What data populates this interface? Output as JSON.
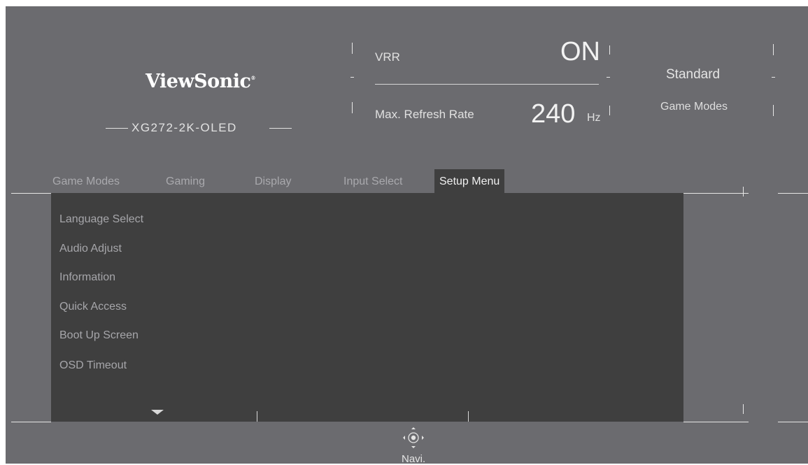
{
  "brand": {
    "logo": "ViewSonic",
    "model": "XG272-2K-OLED"
  },
  "status": {
    "vrr_label": "VRR",
    "vrr_value": "ON",
    "refresh_label": "Max. Refresh Rate",
    "refresh_value": "240",
    "refresh_unit": "Hz",
    "mode_value": "Standard",
    "mode_label": "Game Modes"
  },
  "tabs": [
    {
      "label": "Game Modes",
      "active": false
    },
    {
      "label": "Gaming",
      "active": false
    },
    {
      "label": "Display",
      "active": false
    },
    {
      "label": "Input Select",
      "active": false
    },
    {
      "label": "Setup Menu",
      "active": true
    }
  ],
  "menu_items": [
    {
      "label": "Language Select"
    },
    {
      "label": "Audio Adjust"
    },
    {
      "label": "Information"
    },
    {
      "label": "Quick Access"
    },
    {
      "label": "Boot Up Screen"
    },
    {
      "label": "OSD Timeout"
    }
  ],
  "navi": {
    "label": "Navi.",
    "icon": "joystick-navigation-icon"
  },
  "colors": {
    "background": "#6b6b6f",
    "panel": "#3f3f3f",
    "text": "#d8d8d8",
    "active_tab": "#3f3f3f"
  }
}
